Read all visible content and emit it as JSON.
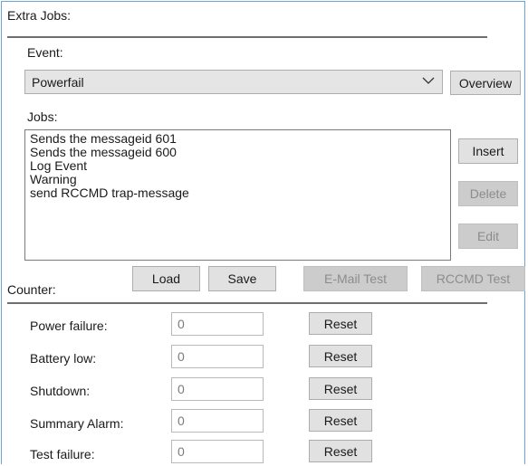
{
  "extra_jobs": {
    "group_label": "Extra Jobs:",
    "event_label": "Event:",
    "event_value": "Powerfail",
    "overview_label": "Overview",
    "jobs_label": "Jobs:",
    "jobs": [
      "Sends the messageid 601",
      "Sends the messageid 600",
      "Log Event",
      "Warning",
      "send RCCMD trap-message"
    ],
    "insert_label": "Insert",
    "delete_label": "Delete",
    "edit_label": "Edit",
    "load_label": "Load",
    "save_label": "Save",
    "email_test_label": "E-Mail Test",
    "rccmd_test_label": "RCCMD Test"
  },
  "counter": {
    "group_label": "Counter:",
    "reset_label": "Reset",
    "rows": [
      {
        "label": "Power failure:",
        "value": "0"
      },
      {
        "label": "Battery low:",
        "value": "0"
      },
      {
        "label": "Shutdown:",
        "value": "0"
      },
      {
        "label": "Summary Alarm:",
        "value": "0"
      },
      {
        "label": "Test failure:",
        "value": "0"
      }
    ]
  }
}
